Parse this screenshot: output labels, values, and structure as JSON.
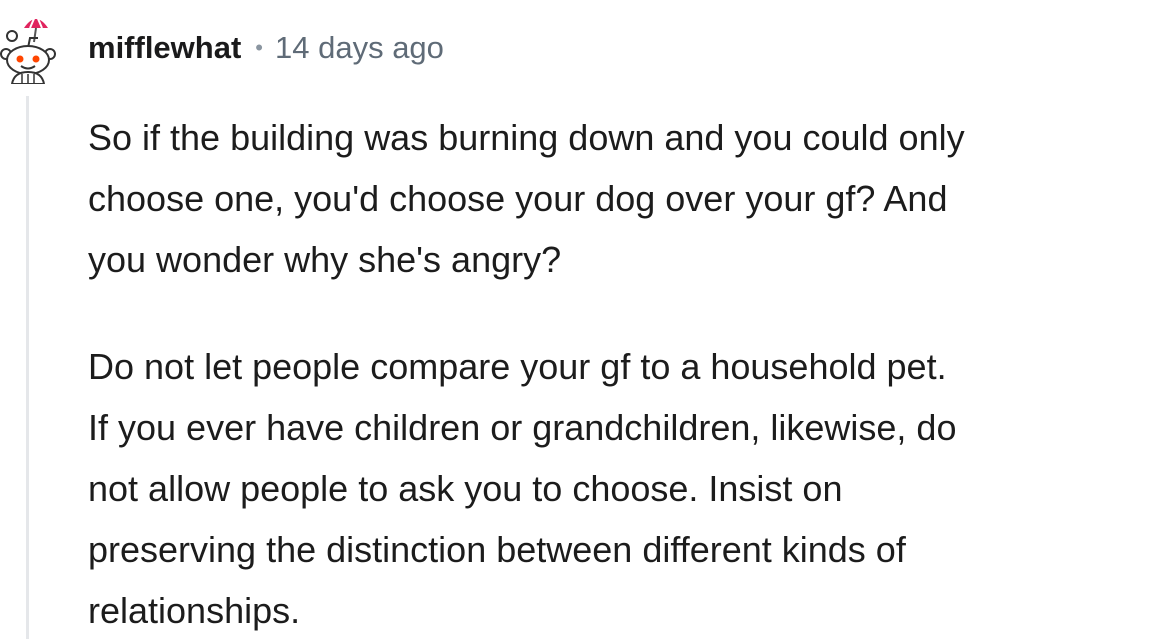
{
  "comment": {
    "author": "mifflewhat",
    "separator": "•",
    "timestamp": "14 days ago",
    "avatar_icon": "reddit-snoo-avatar-icon",
    "paragraphs": [
      {
        "lines": [
          "So if the building was burning down and you could only",
          "choose one, you'd choose your dog over your gf? And",
          "you wonder why she's angry?"
        ]
      },
      {
        "lines": [
          "Do not let people compare your gf to a household pet.",
          "If you ever have children or grandchildren, likewise, do",
          "not allow people to ask you to choose. Insist on",
          "preserving the distinction between different kinds of",
          "relationships."
        ]
      }
    ]
  },
  "colors": {
    "accent_umbrella": "#e0245e",
    "snoo_eye": "#ff4500",
    "thread_line": "#e5e7ea",
    "timestamp": "#5f6b77"
  }
}
